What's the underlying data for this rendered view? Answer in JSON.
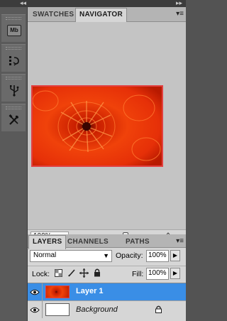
{
  "top_bar": {
    "collapse_left": "◂◂",
    "collapse_right": "▸▸"
  },
  "tools": [
    {
      "name": "mini-bridge",
      "glyph": "Mb"
    },
    {
      "name": "history"
    },
    {
      "name": "usb-device"
    },
    {
      "name": "tools-settings"
    }
  ],
  "navigator_panel": {
    "tabs": [
      {
        "label": "SWATCHES",
        "active": false
      },
      {
        "label": "NAVIGATOR",
        "active": true
      }
    ],
    "menu_icon": "▾≡",
    "zoom_value": "100%",
    "proxy_color": "#e24040"
  },
  "layers_panel": {
    "tabs": [
      {
        "label": "LAYERS",
        "active": true
      },
      {
        "label": "CHANNELS",
        "active": false
      },
      {
        "label": "PATHS",
        "active": false
      }
    ],
    "menu_icon": "▾≡",
    "blend_mode": "Normal",
    "opacity_label": "Opacity:",
    "opacity_value": "100%",
    "lock_label": "Lock:",
    "fill_label": "Fill:",
    "fill_value": "100%",
    "layers": [
      {
        "name": "Layer 1",
        "selected": true,
        "italic": false
      },
      {
        "name": "Background",
        "selected": false,
        "italic": true
      }
    ]
  },
  "colors": {
    "selection_blue": "#3a8ee6",
    "panel_bg": "#d6d6d6",
    "dark_ui": "#535353"
  }
}
